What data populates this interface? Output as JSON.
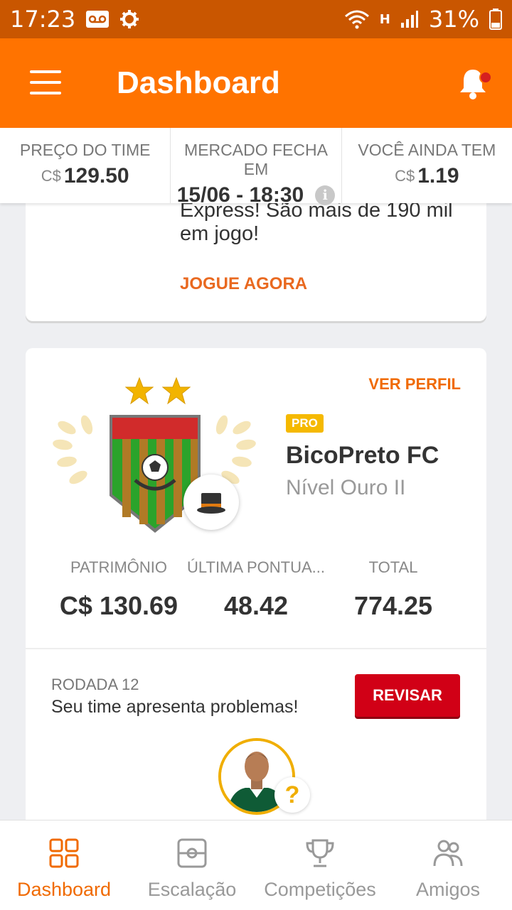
{
  "status_bar": {
    "time": "17:23",
    "network": "H",
    "battery": "31%",
    "icons": [
      "voicemail-icon",
      "settings-icon",
      "wifi-icon",
      "signal-icon",
      "battery-icon"
    ]
  },
  "app_bar": {
    "title": "Dashboard",
    "menu_icon": "hamburger-menu-icon",
    "notification_icon": "bell-icon"
  },
  "info_bar": {
    "team_price": {
      "label": "PREÇO DO TIME",
      "currency": "C$",
      "value": "129.50"
    },
    "market": {
      "label": "MERCADO FECHA EM",
      "value": "15/06 - 18:30",
      "info_icon": "i"
    },
    "balance": {
      "label": "VOCÊ AINDA TEM",
      "currency": "C$",
      "value": "1.19"
    }
  },
  "promo_card": {
    "text": "Express! São mais de 190 mil em jogo!",
    "link": "JOGUE AGORA"
  },
  "team_card": {
    "profile_link": "VER PERFIL",
    "badge": "PRO",
    "team_name": "BicoPreto FC",
    "level": "Nível Ouro II",
    "stars": 2,
    "stats": [
      {
        "label": "PATRIMÔNIO",
        "value": "C$ 130.69"
      },
      {
        "label": "ÚLTIMA PONTUA...",
        "value": "48.42"
      },
      {
        "label": "TOTAL",
        "value": "774.25"
      }
    ],
    "round": {
      "label": "RODADA 12",
      "message": "Seu time apresenta problemas!",
      "button": "REVISAR",
      "question_mark": "?"
    }
  },
  "bottom_nav": [
    {
      "label": "Dashboard",
      "icon": "dashboard-grid-icon",
      "active": true
    },
    {
      "label": "Escalação",
      "icon": "field-icon",
      "active": false
    },
    {
      "label": "Competições",
      "icon": "trophy-icon",
      "active": false
    },
    {
      "label": "Amigos",
      "icon": "friends-icon",
      "active": false
    }
  ],
  "colors": {
    "status_bar": "#c95600",
    "app_bar": "#ff7300",
    "accent": "#f06a00",
    "button": "#d10016",
    "pro_badge": "#f5b900"
  }
}
